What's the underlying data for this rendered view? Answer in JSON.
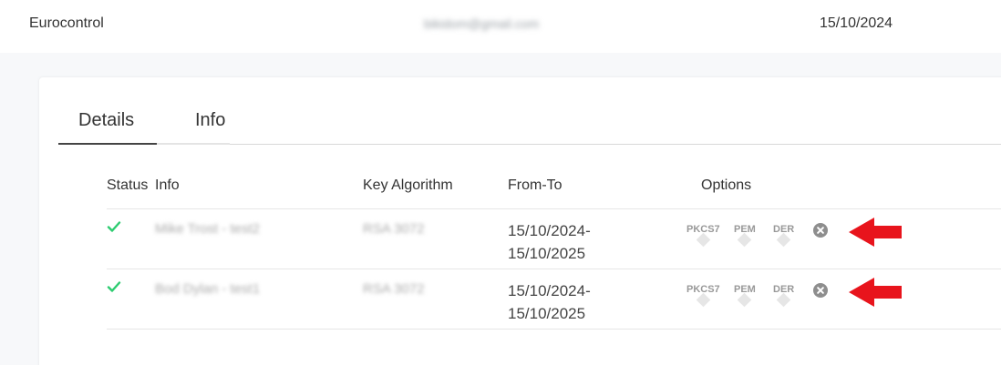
{
  "top_row": {
    "organization": "Eurocontrol",
    "email": "bikidom@gmail.com",
    "date": "15/10/2024"
  },
  "tabs": [
    {
      "label": "Details",
      "active": true
    },
    {
      "label": "Info",
      "active": false
    }
  ],
  "table": {
    "headers": {
      "status": "Status",
      "info": "Info",
      "key_algorithm": "Key Algorithm",
      "from_to": "From-To",
      "options": "Options"
    },
    "rows": [
      {
        "status": "valid",
        "info": "Mike Trost - test2",
        "key_algorithm": "RSA 3072",
        "from": "15/10/2024-",
        "to": "15/10/2025",
        "options": [
          "PKCS7",
          "PEM",
          "DER"
        ]
      },
      {
        "status": "valid",
        "info": "Bod Dylan - test1",
        "key_algorithm": "RSA 3072",
        "from": "15/10/2024-",
        "to": "15/10/2025",
        "options": [
          "PKCS7",
          "PEM",
          "DER"
        ]
      }
    ]
  },
  "colors": {
    "check": "#2ecc71",
    "annotation_arrow": "#e8141c",
    "delete_icon": "#8e8e8e"
  },
  "icons": {
    "status": "check-icon",
    "delete": "close-circle-icon",
    "annotation": "arrow-left-icon"
  }
}
